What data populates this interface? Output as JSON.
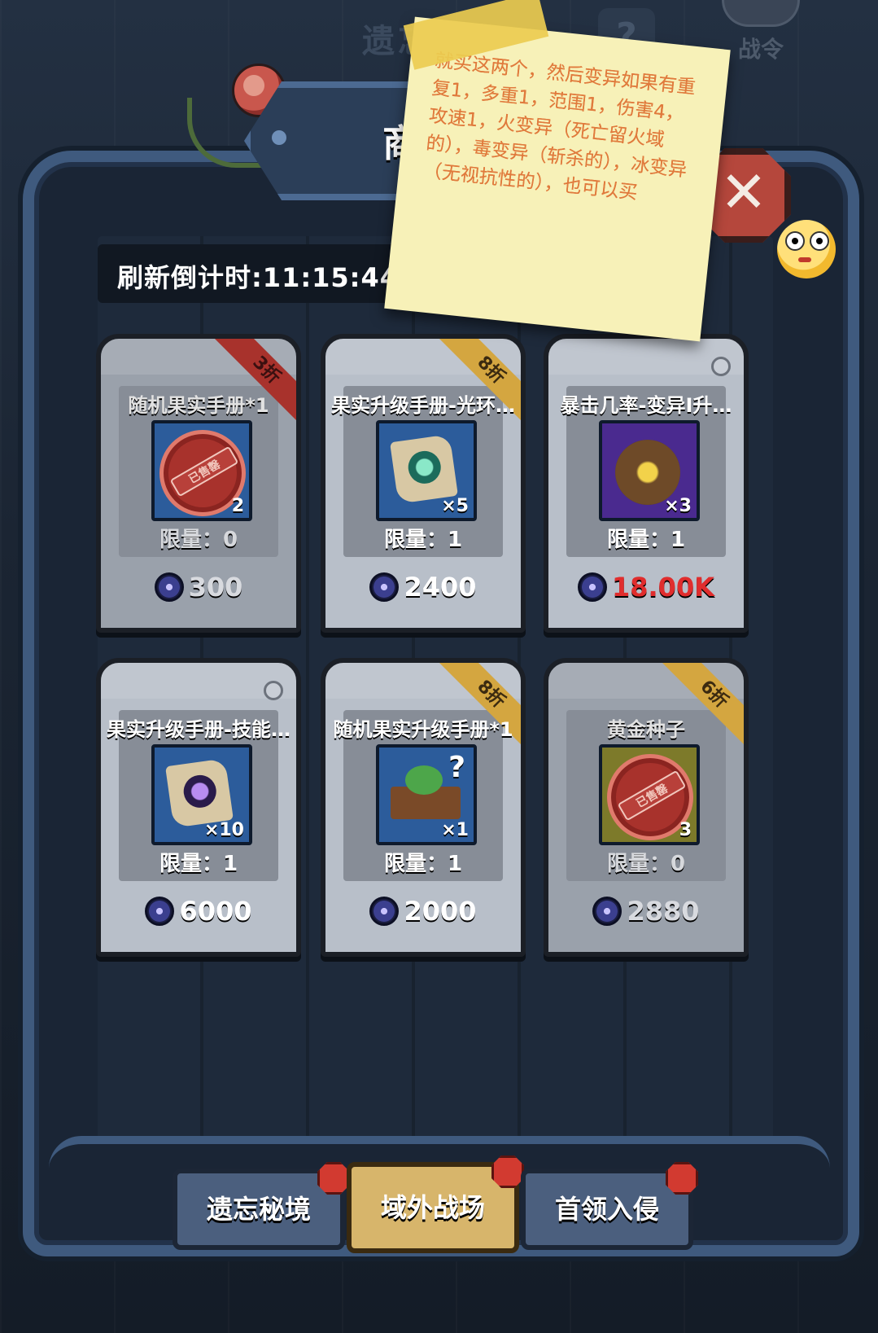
{
  "header": {
    "section_title": "遗忘秘境",
    "help_label": "?",
    "battlepass_label": "战令"
  },
  "shop": {
    "title": "商店",
    "close_label": "✕",
    "refresh_label": "刷新倒计时:11:15:44"
  },
  "note": {
    "text": "就买这两个，然后变异如果有重复1，多重1，范围1，伤害4，攻速1，火变异（死亡留火域的），毒变异（斩杀的），冰变异（无视抗性的），也可以买"
  },
  "items": [
    {
      "name": "随机果实手册*1",
      "badge": "3折",
      "limit": "限量：0",
      "price": "300",
      "qty": "2",
      "sold_stamp": "已售罄",
      "price_color": "#d8dadf"
    },
    {
      "name": "果实升级手册-光环…",
      "badge": "8折",
      "limit": "限量：1",
      "price": "2400",
      "qty": "×5",
      "price_color": "#ffffff"
    },
    {
      "name": "暴击几率-变异I升…",
      "badge": "",
      "limit": "限量：1",
      "price": "18.00K",
      "qty": "×3",
      "price_color": "#e02d2d"
    },
    {
      "name": "果实升级手册-技能…",
      "badge": "",
      "limit": "限量：1",
      "price": "6000",
      "qty": "×10",
      "price_color": "#ffffff"
    },
    {
      "name": "随机果实升级手册*1",
      "badge": "8折",
      "limit": "限量：1",
      "price": "2000",
      "qty": "×1",
      "price_color": "#ffffff"
    },
    {
      "name": "黄金种子",
      "badge": "6折",
      "limit": "限量：0",
      "price": "2880",
      "qty": "3",
      "sold_stamp": "已售罄",
      "price_color": "#d8dadf"
    }
  ],
  "tabs": [
    {
      "label": "遗忘秘境",
      "active": false
    },
    {
      "label": "域外战场",
      "active": true
    },
    {
      "label": "首领入侵",
      "active": false
    }
  ],
  "icons": {
    "currency": "star-gem-icon",
    "close": "close-icon",
    "help": "question-icon"
  }
}
